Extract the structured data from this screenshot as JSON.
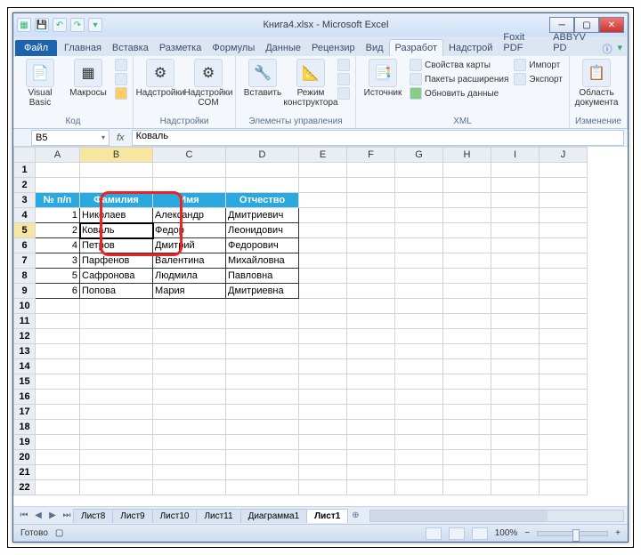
{
  "titlebar": {
    "title": "Книга4.xlsx - Microsoft Excel"
  },
  "tabs": {
    "file": "Файл",
    "items": [
      "Главная",
      "Вставка",
      "Разметка",
      "Формулы",
      "Данные",
      "Рецензир",
      "Вид",
      "Разработ",
      "Надстрой",
      "Foxit PDF",
      "ABBYV PD"
    ],
    "active_index": 7
  },
  "ribbon": {
    "groups": {
      "code": {
        "label": "Код",
        "visual_basic": "Visual Basic",
        "macros": "Макросы"
      },
      "addins": {
        "label": "Надстройки",
        "addins_btn": "Надстройки",
        "com": "Надстройки COM"
      },
      "controls": {
        "label": "Элементы управления",
        "insert": "Вставить",
        "design": "Режим конструктора"
      },
      "xml": {
        "label": "XML",
        "source": "Источник",
        "map_props": "Свойства карты",
        "expansion": "Пакеты расширения",
        "refresh": "Обновить данные",
        "import": "Импорт",
        "export": "Экспорт"
      },
      "modify": {
        "label": "Изменение",
        "area": "Область документа"
      }
    }
  },
  "formula": {
    "name": "B5",
    "fx": "fx",
    "value": "Коваль"
  },
  "columns": [
    "A",
    "B",
    "C",
    "D",
    "E",
    "F",
    "G",
    "H",
    "I",
    "J"
  ],
  "headers": {
    "np": "№ п/п",
    "surname": "Фамилия",
    "name": "Имя",
    "patronymic": "Отчество"
  },
  "rows": [
    {
      "n": "1",
      "s": "Николаев",
      "i": "Александр",
      "o": "Дмитриевич"
    },
    {
      "n": "2",
      "s": "Коваль",
      "i": "Федор",
      "o": "Леонидович"
    },
    {
      "n": "4",
      "s": "Петров",
      "i": "Дмитрий",
      "o": "Федорович"
    },
    {
      "n": "3",
      "s": "Парфенов",
      "i": "Валентина",
      "o": "Михайловна"
    },
    {
      "n": "5",
      "s": "Сафронова",
      "i": "Людмила",
      "o": "Павловна"
    },
    {
      "n": "6",
      "s": "Попова",
      "i": "Мария",
      "o": "Дмитриевна"
    }
  ],
  "sheets": {
    "tabs": [
      "Лист8",
      "Лист9",
      "Лист10",
      "Лист11",
      "Диаграмма1",
      "Лист1"
    ],
    "active_index": 5,
    "extra": "⊕"
  },
  "status": {
    "ready": "Готово",
    "zoom": "100%",
    "minus": "−",
    "plus": "+"
  }
}
